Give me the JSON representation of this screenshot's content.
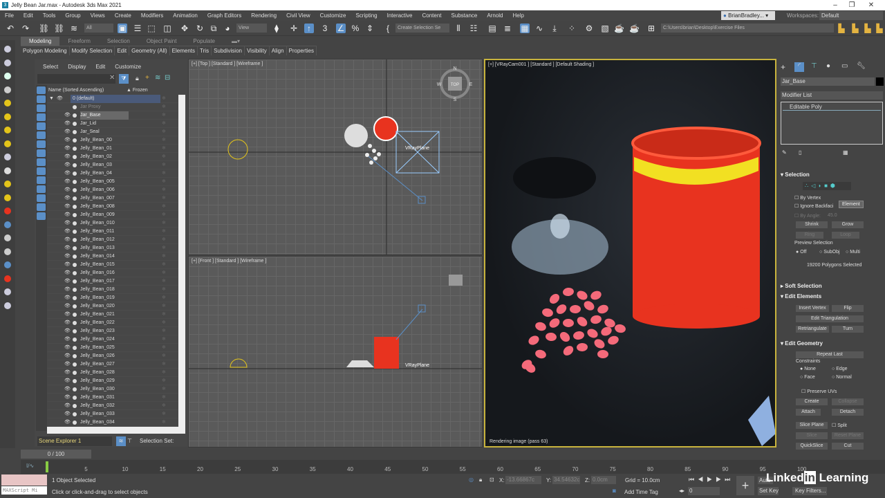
{
  "window": {
    "title": "Jelly Bean Jar.max - Autodesk 3ds Max 2021",
    "app_icon": "3"
  },
  "menu": [
    "File",
    "Edit",
    "Tools",
    "Group",
    "Views",
    "Create",
    "Modifiers",
    "Animation",
    "Graph Editors",
    "Rendering",
    "Civil View",
    "Customize",
    "Scripting",
    "Interactive",
    "Content",
    "Substance",
    "Arnold",
    "Help"
  ],
  "user": {
    "name": "BrianBradley...",
    "workspaces_label": "Workspaces:",
    "workspace": "Default"
  },
  "toolbar": {
    "filter": "All",
    "ref_coord": "View",
    "selection_set": "Create Selection Se",
    "project_path": "C:\\Users\\brian\\Desktop\\Exercise Files"
  },
  "ribbon": {
    "tabs": [
      "Modeling",
      "Freeform",
      "Selection",
      "Object Paint",
      "Populate"
    ],
    "active_tab": "Modeling",
    "panels": [
      "Polygon Modeling",
      "Modify Selection",
      "Edit",
      "Geometry (All)",
      "Elements",
      "Tris",
      "Subdivision",
      "Visibility",
      "Align",
      "Properties"
    ]
  },
  "explorer": {
    "menu": [
      "Select",
      "Display",
      "Edit",
      "Customize"
    ],
    "col_name": "Name (Sorted Ascending)",
    "col_frozen": "▲ Frozen",
    "rows": [
      "0 (default)",
      "Jar Proxy",
      "Jar_Base",
      "Jar_Lid",
      "Jar_Seal",
      "Jelly_Bean_00",
      "Jelly_Bean_01",
      "Jelly_Bean_02",
      "Jelly_Bean_03",
      "Jelly_Bean_04",
      "Jelly_Bean_005",
      "Jelly_Bean_006",
      "Jelly_Bean_007",
      "Jelly_Bean_008",
      "Jelly_Bean_009",
      "Jelly_Bean_010",
      "Jelly_Bean_011",
      "Jelly_Bean_012",
      "Jelly_Bean_013",
      "Jelly_Bean_014",
      "Jelly_Bean_015",
      "Jelly_Bean_016",
      "Jelly_Bean_017",
      "Jelly_Bean_018",
      "Jelly_Bean_019",
      "Jelly_Bean_020",
      "Jelly_Bean_021",
      "Jelly_Bean_022",
      "Jelly_Bean_023",
      "Jelly_Bean_024",
      "Jelly_Bean_025",
      "Jelly_Bean_026",
      "Jelly_Bean_027",
      "Jelly_Bean_028",
      "Jelly_Bean_029",
      "Jelly_Bean_030",
      "Jelly_Bean_031",
      "Jelly_Bean_032",
      "Jelly_Bean_033",
      "Jelly_Bean_034"
    ],
    "selected": "Jar_Base",
    "name": "Scene Explorer 1",
    "selection_set_label": "Selection Set:"
  },
  "viewports": {
    "top": "[+] [Top ] [Standard ] [Wireframe ]",
    "front": "[+] [Front ] [Standard ] [Wireframe ]",
    "camera": "[+] [VRayCam001 ] [Standard ] [Default Shading ]",
    "vrayplane": "VRayPlane",
    "render_status": "Rendering image (pass 63)",
    "viewcube_top": "TOP",
    "compass": [
      "N",
      "E",
      "S",
      "W"
    ]
  },
  "command_panel": {
    "object_name": "Jar_Base",
    "object_color": "#000000",
    "modifier_list": "Modifier List",
    "stack_item": "Editable Poly",
    "selection": {
      "title": "Selection",
      "by_vertex": "By Vertex",
      "ignore_backfacing": "Ignore Backfaci",
      "by_angle": "By Angle:",
      "angle": "45.0",
      "shrink": "Shrink",
      "grow": "Grow",
      "ring": "Ring",
      "loop": "Loop",
      "preview_label": "Preview Selection",
      "preview_options": [
        "Off",
        "SubObj",
        "Multi"
      ],
      "status": "19200 Polygons Selected",
      "tooltip": "Element"
    },
    "soft_selection": "Soft Selection",
    "edit_elements": {
      "title": "Edit Elements",
      "insert_vertex": "Insert Vertex",
      "flip": "Flip",
      "edit_triangulation": "Edit Triangulation",
      "retriangulate": "Retriangulate",
      "turn": "Turn"
    },
    "edit_geometry": {
      "title": "Edit Geometry",
      "repeat_last": "Repeat Last",
      "constraints": "Constraints",
      "none": "None",
      "edge": "Edge",
      "face": "Face",
      "normal": "Normal",
      "preserve_uvs": "Preserve UVs",
      "create": "Create",
      "collapse": "Collapse",
      "attach": "Attach",
      "detach": "Detach",
      "slice_plane": "Slice Plane",
      "split": "Split",
      "slice": "Slice",
      "reset_plane": "Reset Plane",
      "quickslice": "QuickSlice",
      "cut": "Cut"
    }
  },
  "timeline": {
    "frame": "0 / 100",
    "ticks": [
      5,
      10,
      15,
      20,
      25,
      30,
      35,
      40,
      45,
      50,
      55,
      60,
      65,
      70,
      75,
      80,
      85,
      90,
      95,
      100
    ]
  },
  "status": {
    "maxscript": "MAXScript Mi",
    "selected": "1 Object Selected",
    "prompt": "Click or click-and-drag to select objects",
    "x_label": "X:",
    "x": "-13.66867c",
    "y_label": "Y:",
    "y": "34.54632c",
    "z_label": "Z:",
    "z": "0.0cm",
    "grid": "Grid = 10.0cm",
    "add_time_tag": "Add Time Tag",
    "frame": "0",
    "auto_key": "Auto",
    "set_key": "Set Key",
    "key_filters": "Key Filters...",
    "watermark": "Linked in Learning"
  },
  "colors": {
    "accent": "#5b8fc7",
    "jar": "#e8331f",
    "seal": "#f2e022",
    "bean": "#f46a7a",
    "cam_border": "#c9b43d"
  }
}
